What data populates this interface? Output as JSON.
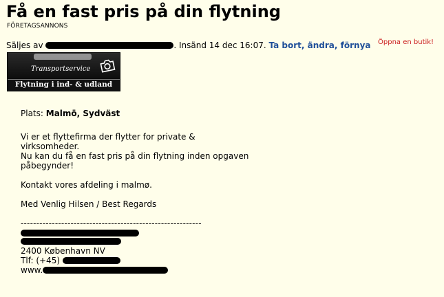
{
  "ad": {
    "title": "Få en fast pris på din flytning",
    "company_label": "FÖRETAGSANNONS",
    "meta": {
      "seller_prefix": "Säljes av",
      "posted_text": ". Insänd 14 dec 16:07.",
      "action_link": "Ta bort, ändra, förnya",
      "shop_link": "Öppna en butik!"
    },
    "logo": {
      "subtitle": "Transportservice",
      "tagline": "Flytning i ind- & udland",
      "icon": "camera-icon"
    },
    "location_label": "Plats:",
    "location_value": "Malmö, Sydväst",
    "description": "Vi er et flyttefirma der flytter for private &\nvirksomheder.\nNu kan du få en fast pris på din flytning inden opgaven\npåbegynder!",
    "contact_line": "Kontakt vores afdeling i malmø.",
    "regards_line": "Med Venlig Hilsen / Best Regards",
    "separator": "----------------------------------------------------------",
    "city_line": "2400 København NV",
    "phone_prefix": "Tlf: (+45)",
    "web_prefix": "www."
  },
  "colors": {
    "background": "#fffeea",
    "link": "#1f4f99",
    "shop_link": "#cc2222"
  }
}
